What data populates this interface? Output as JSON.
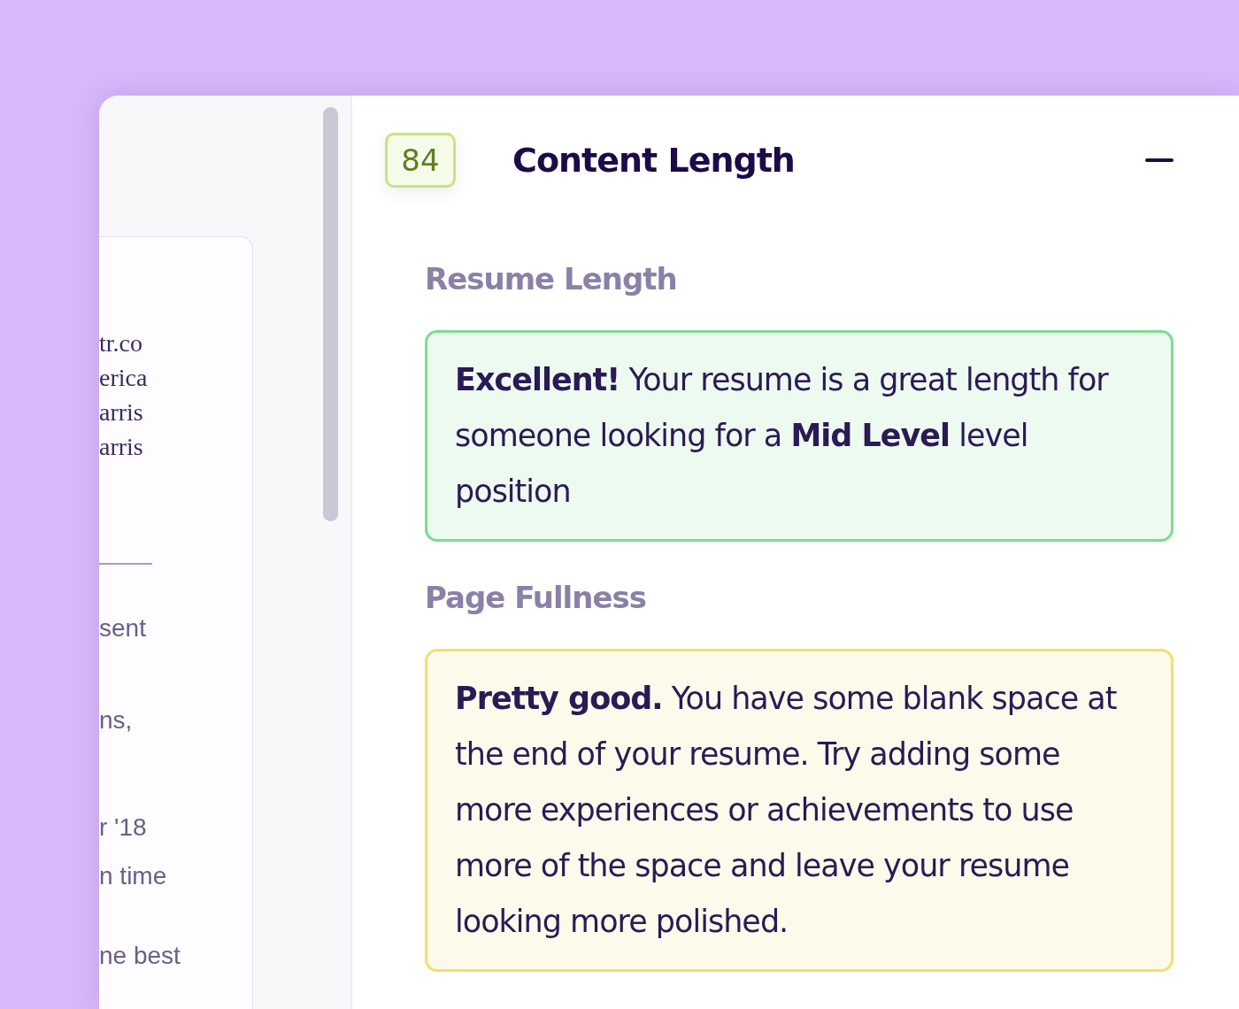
{
  "preview": {
    "lines": [
      {
        "kind": "serif",
        "text": "tr.co"
      },
      {
        "kind": "serif",
        "text": "erica"
      },
      {
        "kind": "serif",
        "text": "arris"
      },
      {
        "kind": "serif",
        "text": "arris"
      },
      {
        "kind": "rule"
      },
      {
        "kind": "sans",
        "text": "sent"
      },
      {
        "kind": "sans",
        "text": "ns,"
      },
      {
        "kind": "sans",
        "text": "r '18"
      },
      {
        "kind": "sans",
        "text": "n time"
      },
      {
        "kind": "sans",
        "text": "ne best"
      }
    ]
  },
  "panel": {
    "score": "84",
    "title": "Content Length",
    "expanded": true,
    "sections": [
      {
        "label": "Resume Length",
        "color": "#7ddc8c",
        "message": "**Excellent!** Your resume is a great length for someone looking for a **Mid Level** level position"
      },
      {
        "label": "Page Fullness",
        "color": "#f7dc6f",
        "message": "**Pretty good.** You have some blank space at the end of your resume. Try adding some more experiences or achievements to use more of the space and leave your resume looking more polished."
      }
    ]
  }
}
